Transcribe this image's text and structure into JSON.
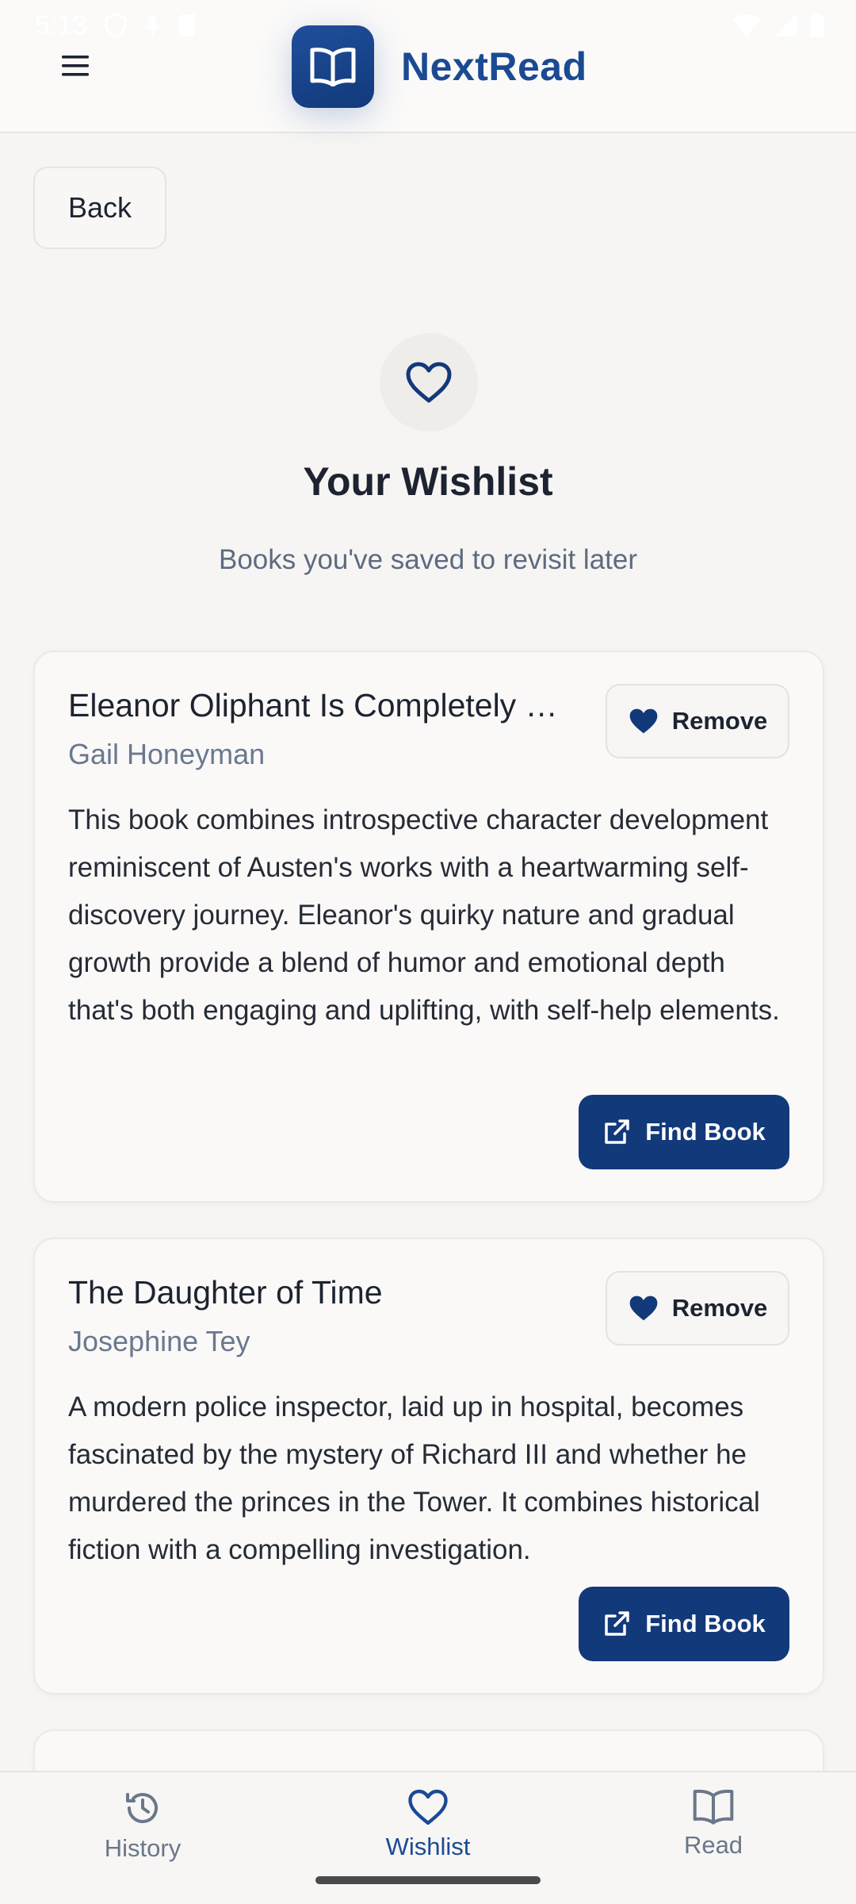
{
  "status_bar": {
    "time": "5:13"
  },
  "header": {
    "app_name": "NextRead"
  },
  "back_label": "Back",
  "hero": {
    "title": "Your Wishlist",
    "subtitle": "Books you've saved to revisit later"
  },
  "books": [
    {
      "title": "Eleanor Oliphant Is Completely Fine",
      "author": "Gail Honeyman",
      "description": "This book combines introspective character development reminiscent of Austen's works with a heartwarming self-discovery journey. Eleanor's quirky nature and gradual growth provide a blend of humor and emotional depth that's both engaging and uplifting, with self-help elements.",
      "remove_label": "Remove",
      "find_label": "Find Book"
    },
    {
      "title": "The Daughter of Time",
      "author": "Josephine Tey",
      "description": "A modern police inspector, laid up in hospital, becomes fascinated by the mystery of Richard III and whether he murdered the princes in the Tower. It combines historical fiction with a compelling investigation.",
      "remove_label": "Remove",
      "find_label": "Find Book"
    }
  ],
  "nav": {
    "items": [
      {
        "label": "History",
        "icon": "history-icon"
      },
      {
        "label": "Wishlist",
        "icon": "heart-icon",
        "active": true
      },
      {
        "label": "Read",
        "icon": "book-open-icon"
      }
    ]
  },
  "colors": {
    "primary": "#12397a",
    "brand_text": "#1b4a94",
    "background": "#f6f5f3",
    "muted_text": "#6a7890"
  }
}
